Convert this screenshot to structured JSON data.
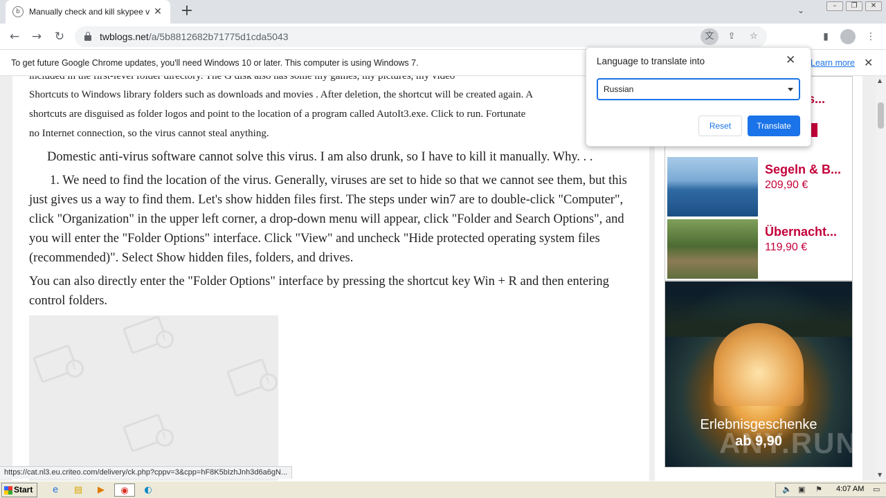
{
  "tab": {
    "title": "Manually check and kill skypee virus"
  },
  "address_bar": {
    "domain": "twblogs.net",
    "path": "/a/5b8812682b71775d1cda5043"
  },
  "infobar": {
    "message": "To get future Google Chrome updates, you'll need Windows 10 or later. This computer is using Windows 7.",
    "link": "Learn more"
  },
  "article": {
    "line_cut": "included in the first-level folder directory. The G disk also has some my games, my pictures, my video",
    "line1": "Shortcuts to Windows library folders such as downloads and movies . After deletion, the shortcut will be created again. A",
    "line2": "shortcuts are disguised as folder logos and point to the location of a program called AutoIt3.exe. Click to run. Fortunate",
    "line3": "no Internet connection, so the virus cannot steal anything.",
    "para_domestic": "Domestic anti-virus software cannot solve this virus. I am also drunk, so I have to kill it manually. Why. . .",
    "para_step1": "1. We need to find the location of the virus. Generally, viruses are set to hide so that we cannot see them, but this just gives us a way to find them. Let's show hidden files first. The steps under win7 are to double-click \"Computer\", click \"Organization\" in the upper left corner, a drop-down menu will appear, click \"Folder and Search Options\", and you will enter the \"Folder Options\" interface. Click \"View\" and uncheck \"Hide protected operating system files (recommended)\". Select Show hidden files, folders, and drives.",
    "para_shortcut": "You can also directly enter the \"Folder Options\" interface by pressing the shortcut key Win + R and then entering control folders."
  },
  "ads": {
    "items": [
      {
        "title": "Segeln & B...",
        "price": "209,90 €"
      },
      {
        "title": "Übernacht...",
        "price": "119,90 €"
      }
    ],
    "top_title_fragment": "ss...",
    "banner_headline": "Erlebnisgeschenke",
    "banner_price": "ab 9,90",
    "watermark": "ANY.RUN"
  },
  "status_url": "https://cat.nl3.eu.criteo.com/delivery/ck.php?cppv=3&cpp=hF8K5bIzhJnh3d6a6gN...",
  "translate_popup": {
    "title": "Language to translate into",
    "selected_language": "Russian",
    "reset_label": "Reset",
    "translate_label": "Translate"
  },
  "taskbar": {
    "start_label": "Start",
    "clock": "4:07 AM"
  },
  "colors": {
    "accent": "#1a73e8",
    "ad_text": "#c3003a",
    "taskbar": "#ece9d8"
  }
}
